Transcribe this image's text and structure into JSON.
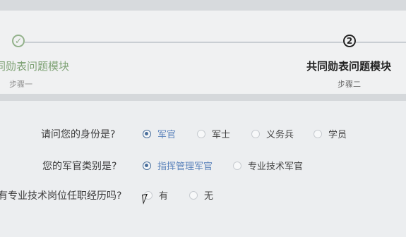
{
  "stepper": {
    "steps": [
      {
        "index_text": "✓",
        "title": "同勋表问题模块",
        "subtitle": "步骤一",
        "state": "done"
      },
      {
        "index_text": "2",
        "title": "共同勋表问题模块",
        "subtitle": "步骤二",
        "state": "active"
      }
    ]
  },
  "form": {
    "questions": [
      {
        "label": "请问您的身份是?",
        "options": [
          "军官",
          "军士",
          "义务兵",
          "学员"
        ],
        "selected": "军官"
      },
      {
        "label": "您的军官类别是?",
        "options": [
          "指挥管理军官",
          "专业技术军官"
        ],
        "selected": "指挥管理军官"
      },
      {
        "label": "有专业技术岗位任职经历吗?",
        "options": [
          "有",
          "无"
        ],
        "selected": null
      }
    ]
  },
  "colors": {
    "completed_step": "#7ea274",
    "active_step": "#222222",
    "selected_option": "#5b83bb",
    "radio_selected": "#4a6f9c"
  }
}
